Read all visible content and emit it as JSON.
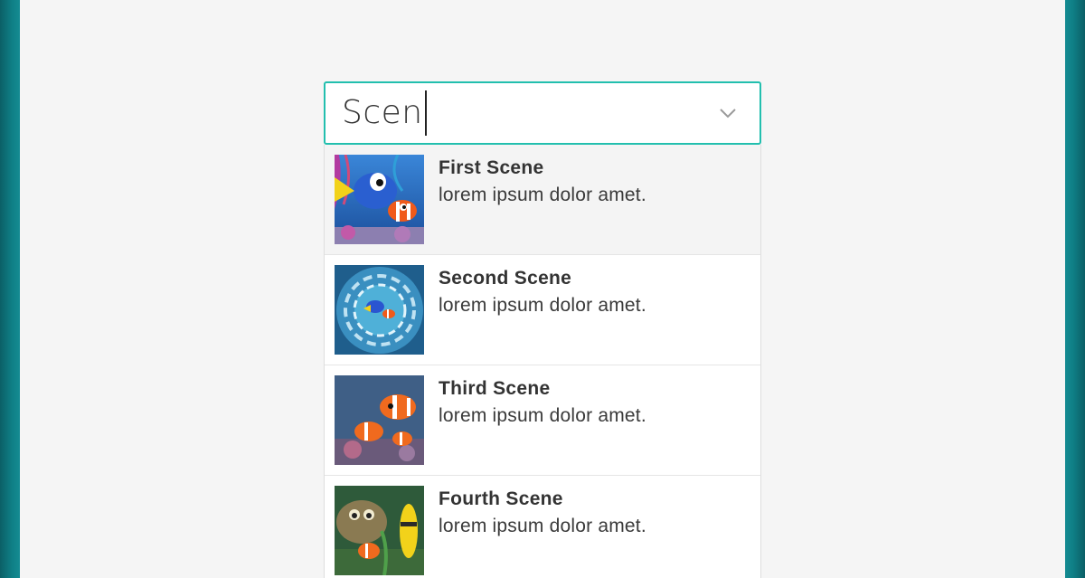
{
  "combobox": {
    "value": "Scen",
    "toggle_icon": "chevron-down-icon",
    "accent_color": "#22bfae"
  },
  "options": [
    {
      "title": "First Scene",
      "description": "lorem ipsum dolor amet.",
      "thumbnail": "dory-and-nemo-image"
    },
    {
      "title": "Second Scene",
      "description": "lorem ipsum dolor amet.",
      "thumbnail": "whirlpool-image"
    },
    {
      "title": "Third Scene",
      "description": "lorem ipsum dolor amet.",
      "thumbnail": "clownfish-image"
    },
    {
      "title": "Fourth Scene",
      "description": "lorem ipsum dolor amet.",
      "thumbnail": "tank-gang-image"
    }
  ]
}
